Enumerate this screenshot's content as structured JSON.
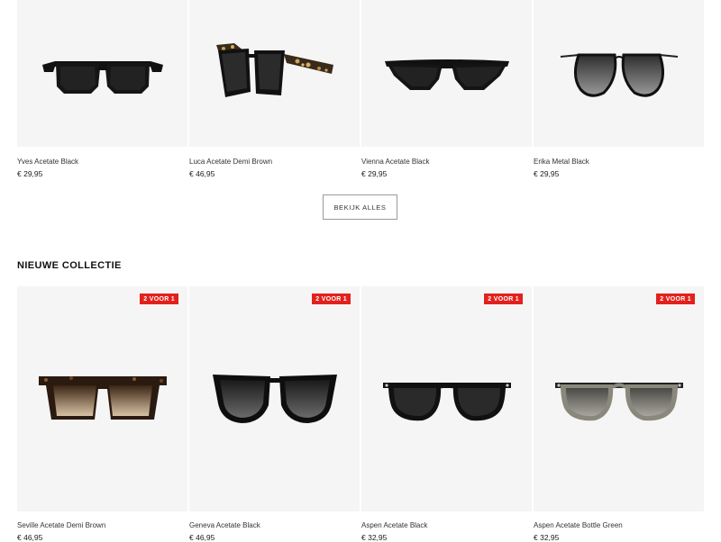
{
  "top_products": [
    {
      "name": "Yves Acetate Black",
      "price": "€ 29,95",
      "icon": "sunglasses-rectangular-black"
    },
    {
      "name": "Luca Acetate Demi Brown",
      "price": "€ 46,95",
      "icon": "sunglasses-square-tortoise-black"
    },
    {
      "name": "Vienna Acetate Black",
      "price": "€ 29,95",
      "icon": "sunglasses-cateye-black"
    },
    {
      "name": "Erika Metal Black",
      "price": "€ 29,95",
      "icon": "sunglasses-round-metal-black"
    }
  ],
  "view_all": {
    "label": "BEKIJK ALLES"
  },
  "new_collection": {
    "title": "NIEUWE COLLECTIE",
    "products": [
      {
        "name": "Seville Acetate Demi Brown",
        "price": "€ 46,95",
        "badge": "2 VOOR 1",
        "icon": "sunglasses-square-tortoise-gradient"
      },
      {
        "name": "Geneva Acetate Black",
        "price": "€ 46,95",
        "badge": "2 VOOR 1",
        "icon": "sunglasses-butterfly-black"
      },
      {
        "name": "Aspen Acetate Black",
        "price": "€ 32,95",
        "badge": "2 VOOR 1",
        "icon": "sunglasses-round-black"
      },
      {
        "name": "Aspen Acetate Bottle Green",
        "price": "€ 32,95",
        "badge": "2 VOOR 1",
        "icon": "sunglasses-round-green"
      }
    ]
  },
  "colors": {
    "badge": "#e3211c",
    "image_bg": "#f5f5f5",
    "text": "#1a1a1a"
  }
}
